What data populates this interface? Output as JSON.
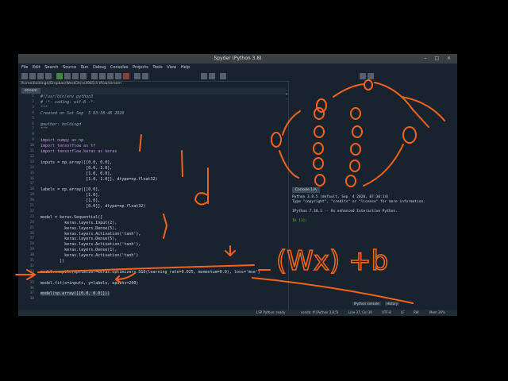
{
  "window": {
    "title": "Spyder (Python 3.8)",
    "controls": "– □ ×"
  },
  "menu": [
    "File",
    "Edit",
    "Search",
    "Source",
    "Run",
    "Debug",
    "Consoles",
    "Projects",
    "Tools",
    "View",
    "Help"
  ],
  "toolbar": {
    "path_value": "/home/boldingd/Dropbox/WestGA/cs4985/3 NN and Keras"
  },
  "editor": {
    "path": "/home/boldingd/Dropbox/WestGA/cs4985/4 tflow/stream",
    "tab_label": "stream",
    "lines": [
      {
        "n": "1",
        "t": "#!/usr/bin/env python3",
        "c": "cm"
      },
      {
        "n": "2",
        "t": "# -*- coding: utf-8 -*-",
        "c": "cm"
      },
      {
        "n": "3",
        "t": "\"\"\"",
        "c": "cm"
      },
      {
        "n": "4",
        "t": "Created on Sat Sep  5 03:58:48 2020",
        "c": "cm"
      },
      {
        "n": "5",
        "t": "",
        "c": ""
      },
      {
        "n": "6",
        "t": "@author: boldingd",
        "c": "cm"
      },
      {
        "n": "7",
        "t": "\"\"\"",
        "c": "cm"
      },
      {
        "n": "8",
        "t": "",
        "c": ""
      },
      {
        "n": "9",
        "t": "import numpy as np",
        "c": "kw"
      },
      {
        "n": "10",
        "t": "import tensorflow as tf",
        "c": "kw"
      },
      {
        "n": "11",
        "t": "import tensorflow.keras as keras",
        "c": "kw"
      },
      {
        "n": "12",
        "t": "",
        "c": ""
      },
      {
        "n": "13",
        "t": "inputs = np.array([[0.0, 0.0],",
        "c": ""
      },
      {
        "n": "14",
        "t": "                   [0.0, 1.0],",
        "c": ""
      },
      {
        "n": "15",
        "t": "                   [1.0, 0.0],",
        "c": ""
      },
      {
        "n": "16",
        "t": "                   [1.0, 1.0]], dtype=np.float32)",
        "c": ""
      },
      {
        "n": "17",
        "t": "",
        "c": ""
      },
      {
        "n": "18",
        "t": "labels = np.array([[0.0],",
        "c": ""
      },
      {
        "n": "19",
        "t": "                   [1.0],",
        "c": ""
      },
      {
        "n": "20",
        "t": "                   [1.0],",
        "c": ""
      },
      {
        "n": "21",
        "t": "                   [0.0]], dtype=np.float32)",
        "c": ""
      },
      {
        "n": "22",
        "t": "",
        "c": ""
      },
      {
        "n": "23",
        "t": "model = keras.Sequential([",
        "c": ""
      },
      {
        "n": "24",
        "t": "          keras.layers.Input(2),",
        "c": ""
      },
      {
        "n": "25",
        "t": "          keras.layers.Dense(5),",
        "c": ""
      },
      {
        "n": "26",
        "t": "          keras.layers.Activation('tanh'),",
        "c": ""
      },
      {
        "n": "27",
        "t": "          keras.layers.Dense(5),",
        "c": ""
      },
      {
        "n": "28",
        "t": "          keras.layers.Activation('tanh'),",
        "c": ""
      },
      {
        "n": "29",
        "t": "          keras.layers.Dense(1),",
        "c": ""
      },
      {
        "n": "30",
        "t": "          keras.layers.Activation('tanh')",
        "c": ""
      },
      {
        "n": "31",
        "t": "        ])",
        "c": ""
      },
      {
        "n": "32",
        "t": "",
        "c": ""
      },
      {
        "n": "33",
        "t": "model.compile(optimizer=keras.optimizers.SGD(learning_rate=0.025, momentum=0.9), loss='mse')",
        "c": ""
      },
      {
        "n": "34",
        "t": "",
        "c": ""
      },
      {
        "n": "35",
        "t": "model.fit(x=inputs, y=labels, epochs=200)",
        "c": ""
      },
      {
        "n": "36",
        "t": "",
        "c": ""
      },
      {
        "n": "37",
        "t": "model(np.array([[0.0, 0.0]]))",
        "c": "hl"
      },
      {
        "n": "38",
        "t": "",
        "c": ""
      }
    ]
  },
  "variable_pane": {
    "tabs": [
      "Variable explorer",
      "Help",
      "Plots",
      "Files"
    ]
  },
  "console": {
    "tab_label": "Console 1/A",
    "text": "Python 3.8.5 (default, Sep  4 2020, 07:30:14)\nType \"copyright\", \"credits\" or \"license\" for more information.\n\nIPython 7.18.1 -- An enhanced Interactive Python.\n\n",
    "prompt": "In [1]:",
    "bottom_tabs": [
      "IPython console",
      "History"
    ]
  },
  "statusbar": {
    "lsp": "LSP Python: ready",
    "env": "conda: tf (Python 3.8.5)",
    "position": "Line 37, Col 30",
    "encoding": "UTF-8",
    "eol": "LF",
    "perm": "RW",
    "mem": "Mem 26%"
  },
  "ink": {
    "annotation": "(Wx) +b",
    "colors": {
      "ink": "#f4631e"
    }
  }
}
